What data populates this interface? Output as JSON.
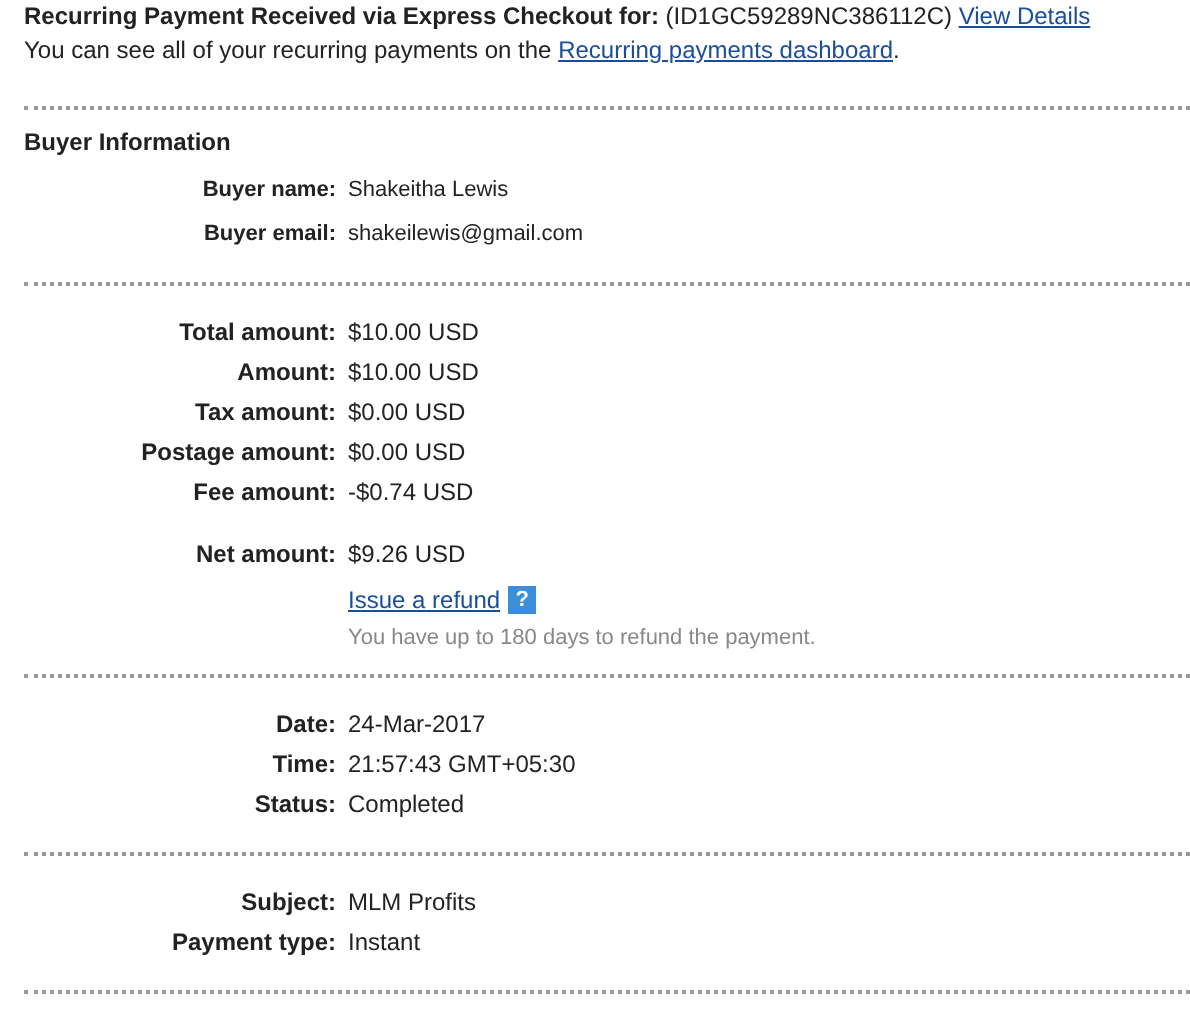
{
  "header": {
    "title": "Recurring Payment Received via Express Checkout for:",
    "id": "(ID1GC59289NC386112C)",
    "details_link": "View Details",
    "note": "You can see all of your recurring payments on the",
    "note_link": "Recurring payments dashboard",
    "note_end": "."
  },
  "sections": [
    {
      "title": "Buyer Information",
      "kind": "compact",
      "groups": [
        [
          {
            "label": "Buyer name:",
            "value": "Shakeitha Lewis"
          },
          {
            "label": "Buyer email:",
            "value": "shakeilewis@gmail.com"
          }
        ]
      ]
    },
    {
      "kind": "normal",
      "groups": [
        [
          {
            "label": "Total amount:",
            "value": "$10.00 USD"
          },
          {
            "label": "Amount:",
            "value": "$10.00 USD"
          },
          {
            "label": "Tax amount:",
            "value": "$0.00 USD"
          },
          {
            "label": "Postage amount:",
            "value": "$0.00 USD"
          },
          {
            "label": "Fee amount:",
            "value": "-$0.74 USD"
          }
        ],
        [
          {
            "label": "Net amount:",
            "value": "$9.26 USD"
          }
        ]
      ],
      "refund": {
        "link": "Issue a refund",
        "help": "?",
        "note": "You have up to 180 days to refund the payment."
      }
    },
    {
      "kind": "normal",
      "groups": [
        [
          {
            "label": "Date:",
            "value": "24-Mar-2017"
          },
          {
            "label": "Time:",
            "value": "21:57:43 GMT+05:30"
          },
          {
            "label": "Status:",
            "value": "Completed"
          }
        ]
      ]
    },
    {
      "kind": "normal",
      "groups": [
        [
          {
            "label": "Subject:",
            "value": "MLM Profits"
          },
          {
            "label": "Payment type:",
            "value": "Instant"
          }
        ]
      ]
    }
  ]
}
